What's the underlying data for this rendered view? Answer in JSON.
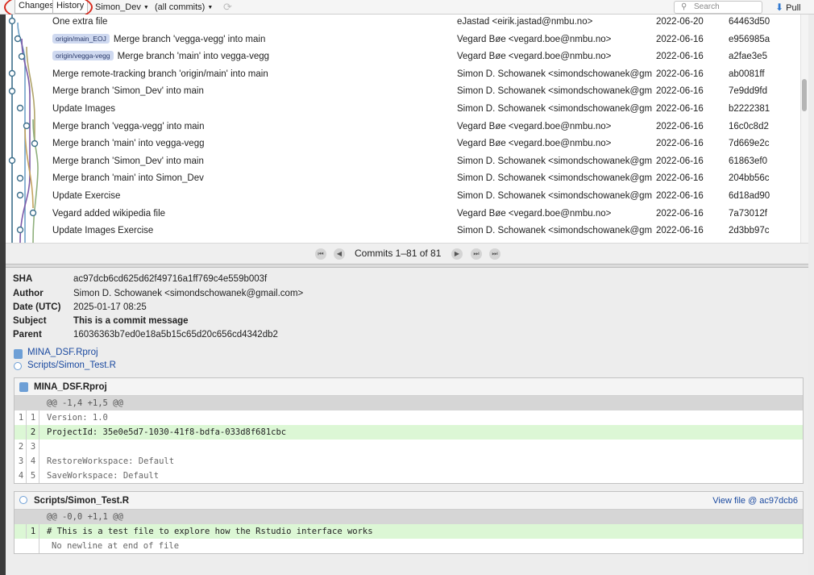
{
  "toolbar": {
    "changes_label": "Changes",
    "history_label": "History",
    "branch": "Simon_Dev",
    "filter": "(all commits)",
    "search_placeholder": "Search",
    "pull_label": "Pull"
  },
  "commits": [
    {
      "refs": [],
      "subject": "One extra file",
      "author": "eJastad <eirik.jastad@nmbu.no>",
      "date": "2022-06-20",
      "sha": "64463d50"
    },
    {
      "refs": [
        "origin/main_EOJ"
      ],
      "subject": "Merge branch 'vegga-vegg' into main",
      "author": "Vegard Bøe <vegard.boe@nmbu.no>",
      "date": "2022-06-16",
      "sha": "e956985a"
    },
    {
      "refs": [
        "origin/vegga-vegg"
      ],
      "subject": "Merge branch 'main' into vegga-vegg",
      "author": "Vegard Bøe <vegard.boe@nmbu.no>",
      "date": "2022-06-16",
      "sha": "a2fae3e5"
    },
    {
      "refs": [],
      "subject": "Merge remote-tracking branch 'origin/main' into main",
      "author": "Simon D. Schowanek <simondschowanek@gm",
      "date": "2022-06-16",
      "sha": "ab0081ff"
    },
    {
      "refs": [],
      "subject": "Merge branch 'Simon_Dev' into main",
      "author": "Simon D. Schowanek <simondschowanek@gm",
      "date": "2022-06-16",
      "sha": "7e9dd9fd"
    },
    {
      "refs": [],
      "subject": "Update Images",
      "author": "Simon D. Schowanek <simondschowanek@gm",
      "date": "2022-06-16",
      "sha": "b2222381"
    },
    {
      "refs": [],
      "subject": "Merge branch 'vegga-vegg' into main",
      "author": "Vegard Bøe <vegard.boe@nmbu.no>",
      "date": "2022-06-16",
      "sha": "16c0c8d2"
    },
    {
      "refs": [],
      "subject": "Merge branch 'main' into vegga-vegg",
      "author": "Vegard Bøe <vegard.boe@nmbu.no>",
      "date": "2022-06-16",
      "sha": "7d669e2c"
    },
    {
      "refs": [],
      "subject": "Merge branch 'Simon_Dev' into main",
      "author": "Simon D. Schowanek <simondschowanek@gm",
      "date": "2022-06-16",
      "sha": "61863ef0"
    },
    {
      "refs": [],
      "subject": "Merge branch 'main' into Simon_Dev",
      "author": "Simon D. Schowanek <simondschowanek@gm",
      "date": "2022-06-16",
      "sha": "204bb56c"
    },
    {
      "refs": [],
      "subject": "Update Exercise",
      "author": "Simon D. Schowanek <simondschowanek@gm",
      "date": "2022-06-16",
      "sha": "6d18ad90"
    },
    {
      "refs": [],
      "subject": "Vegard added wikipedia file",
      "author": "Vegard Bøe <vegard.boe@nmbu.no>",
      "date": "2022-06-16",
      "sha": "7a73012f"
    },
    {
      "refs": [],
      "subject": "Update Images Exercise",
      "author": "Simon D. Schowanek <simondschowanek@gm",
      "date": "2022-06-16",
      "sha": "2d3bb97c"
    }
  ],
  "pager": {
    "label": "Commits 1–81 of 81"
  },
  "details": {
    "sha_label": "SHA",
    "sha": "ac97dcb6cd625d62f49716a1ff769c4e559b003f",
    "author_label": "Author",
    "author": "Simon D. Schowanek <simondschowanek@gmail.com>",
    "date_label": "Date (UTC)",
    "date": "2025-01-17 08:25",
    "subject_label": "Subject",
    "subject": "This is a commit message",
    "parent_label": "Parent",
    "parent": "16036363b7ed0e18a5b15c65d20c656cd4342db2",
    "files": [
      "MINA_DSF.Rproj",
      "Scripts/Simon_Test.R"
    ]
  },
  "diffs": [
    {
      "file": "MINA_DSF.Rproj",
      "hunk": "@@ -1,4 +1,5 @@",
      "lines": [
        {
          "old": "1",
          "new": "1",
          "text": "Version: 1.0",
          "type": "ctx"
        },
        {
          "old": "",
          "new": "2",
          "text": "ProjectId: 35e0e5d7-1030-41f8-bdfa-033d8f681cbc",
          "type": "add"
        },
        {
          "old": "2",
          "new": "3",
          "text": "",
          "type": "ctx"
        },
        {
          "old": "3",
          "new": "4",
          "text": "RestoreWorkspace: Default",
          "type": "ctx"
        },
        {
          "old": "4",
          "new": "5",
          "text": "SaveWorkspace: Default",
          "type": "ctx"
        }
      ]
    },
    {
      "file": "Scripts/Simon_Test.R",
      "view_file": "View file @ ac97dcb6",
      "hunk": "@@ -0,0 +1,1 @@",
      "lines": [
        {
          "old": "",
          "new": "1",
          "text": "# This is a test file to explore how the Rstudio interface works",
          "type": "add"
        }
      ],
      "note": "No newline at end of file"
    }
  ],
  "graph_colors": [
    "#3d6f8c",
    "#6fa2c8",
    "#7c5aa8",
    "#b0a46a",
    "#8fb07d",
    "#c5a35e"
  ]
}
